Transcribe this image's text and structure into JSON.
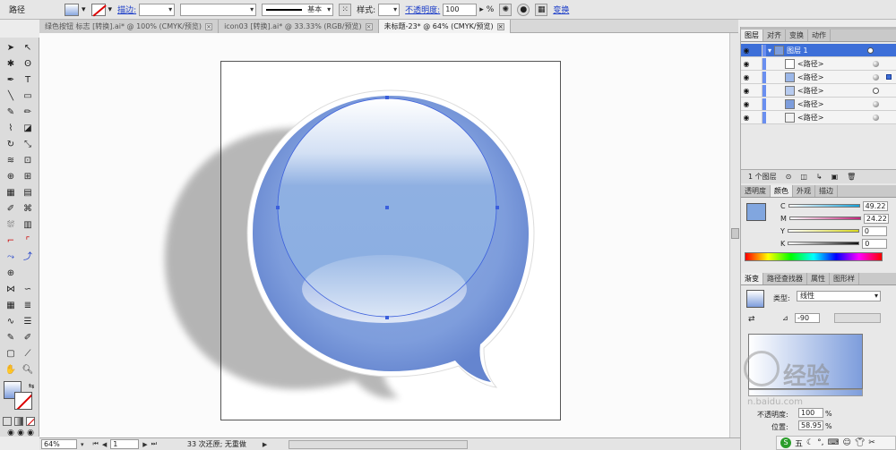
{
  "control_bar": {
    "selection_type": "路径",
    "stroke_label": "描边:",
    "stroke_profile": "基本",
    "style_label": "样式:",
    "opacity_label": "不透明度:",
    "opacity_value": "100",
    "opacity_unit": "%",
    "transform_link": "变换"
  },
  "document_tabs": [
    {
      "label": "绿色按钮 标志 [转换].ai* @ 100% (CMYK/预览)",
      "active": false
    },
    {
      "label": "icon03 [转换].ai* @ 33.33% (RGB/预览)",
      "active": false
    },
    {
      "label": "未标题-23* @ 64% (CMYK/预览)",
      "active": true
    }
  ],
  "status_bar": {
    "zoom": "64%",
    "page": "1",
    "undo_text": "33 次还原; 无重做"
  },
  "layers_panel": {
    "tabs": [
      "图层",
      "对齐",
      "变换",
      "动作"
    ],
    "layers": [
      {
        "name": "图层 1",
        "main": true
      },
      {
        "name": "<路径>"
      },
      {
        "name": "<路径>"
      },
      {
        "name": "<路径>"
      },
      {
        "name": "<路径>"
      },
      {
        "name": "<路径>"
      }
    ],
    "footer": "1 个图层"
  },
  "color_panel": {
    "tabs": [
      "透明度",
      "颜色",
      "外观",
      "描边"
    ],
    "channels": [
      {
        "label": "C",
        "value": "49.22",
        "color": "#16a1d8"
      },
      {
        "label": "M",
        "value": "24.22",
        "color": "#c2257b"
      },
      {
        "label": "Y",
        "value": "0",
        "color": "#d8d81e"
      },
      {
        "label": "K",
        "value": "0",
        "color": "#111111"
      }
    ],
    "swatch": "#81a6df"
  },
  "gradient_panel": {
    "tabs": [
      "渐变",
      "路径查找器",
      "属性",
      "图形样"
    ],
    "type_label": "类型:",
    "type_value": "线性",
    "angle_value": "-90",
    "opacity_label": "不透明度:",
    "opacity_value": "100",
    "location_label": "位置:",
    "location_value": "58.95",
    "unit": "%"
  },
  "ime_bar": {
    "label": "五"
  },
  "watermark": {
    "text": "经验",
    "sub": "n.baidu.com"
  },
  "colors": {
    "bubble_outer": "#7390d6",
    "bubble_inner": "#8eaee2",
    "selection": "#3b5fdc"
  }
}
